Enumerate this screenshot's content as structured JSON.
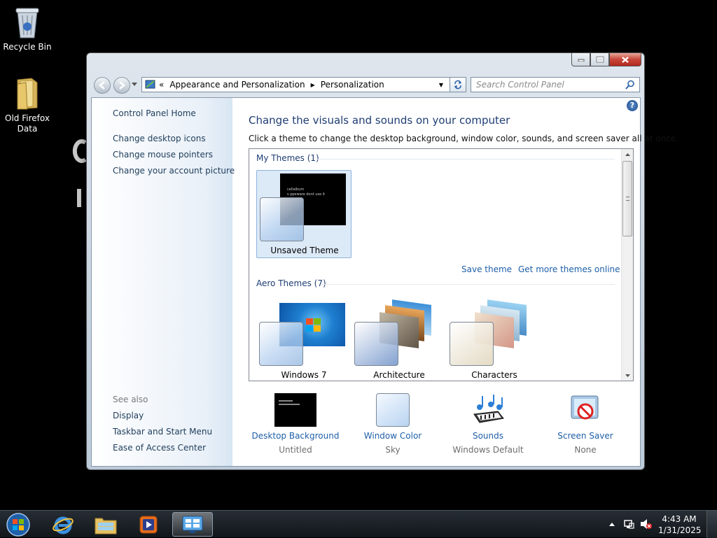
{
  "desktop": {
    "icons": [
      {
        "label": "Recycle Bin"
      },
      {
        "label": "Old Firefox Data"
      }
    ]
  },
  "window": {
    "address": {
      "chevron": "«",
      "crumbs": [
        "Appearance and Personalization",
        "Personalization"
      ]
    },
    "search_placeholder": "Search Control Panel",
    "help_glyph": "?",
    "left_nav": {
      "home": "Control Panel Home",
      "links": [
        "Change desktop icons",
        "Change mouse pointers",
        "Change your account picture"
      ],
      "see_also_header": "See also",
      "see_also": [
        "Display",
        "Taskbar and Start Menu",
        "Ease of Access Center"
      ]
    },
    "content": {
      "title": "Change the visuals and sounds on your computer",
      "subtitle": "Click a theme to change the desktop background, window color, sounds, and screen saver all at once.",
      "my_themes": {
        "header": "My Themes (1)",
        "items": [
          {
            "label": "Unsaved Theme",
            "selected": true,
            "preview_text": [
              "cellalbum",
              "s ppeware dont use it"
            ]
          }
        ]
      },
      "save_theme": "Save theme",
      "get_more": "Get more themes online",
      "aero_themes": {
        "header": "Aero Themes (7)",
        "items": [
          {
            "label": "Windows 7"
          },
          {
            "label": "Architecture"
          },
          {
            "label": "Characters"
          }
        ]
      },
      "bottom": [
        {
          "label": "Desktop Background",
          "value": "Untitled"
        },
        {
          "label": "Window Color",
          "value": "Sky"
        },
        {
          "label": "Sounds",
          "value": "Windows Default"
        },
        {
          "label": "Screen Saver",
          "value": "None"
        }
      ]
    }
  },
  "taskbar": {
    "time": "4:43 AM",
    "date": "1/31/2025",
    "colors": {
      "accent": "#1e5fa8",
      "title": "#1e3d73"
    }
  }
}
